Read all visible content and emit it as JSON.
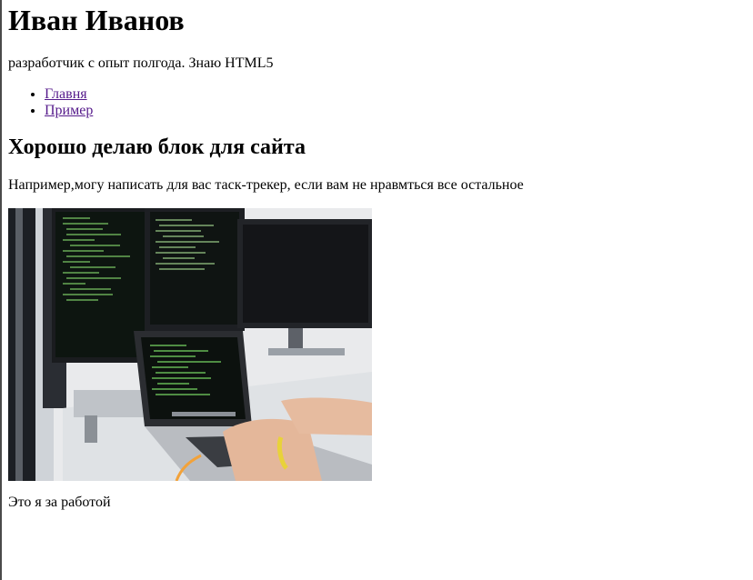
{
  "header": {
    "name": "Иван Иванов",
    "intro": "разработчик с опыт полгода. Знаю HTML5"
  },
  "nav": {
    "items": [
      {
        "label": "Главня"
      },
      {
        "label": "Пример"
      }
    ]
  },
  "main": {
    "heading": "Хорошо делаю блок для сайта",
    "description": "Например,могу написать для вас таск-трекер, если вам не нравмться все остальное",
    "caption": "Это я за работой"
  }
}
